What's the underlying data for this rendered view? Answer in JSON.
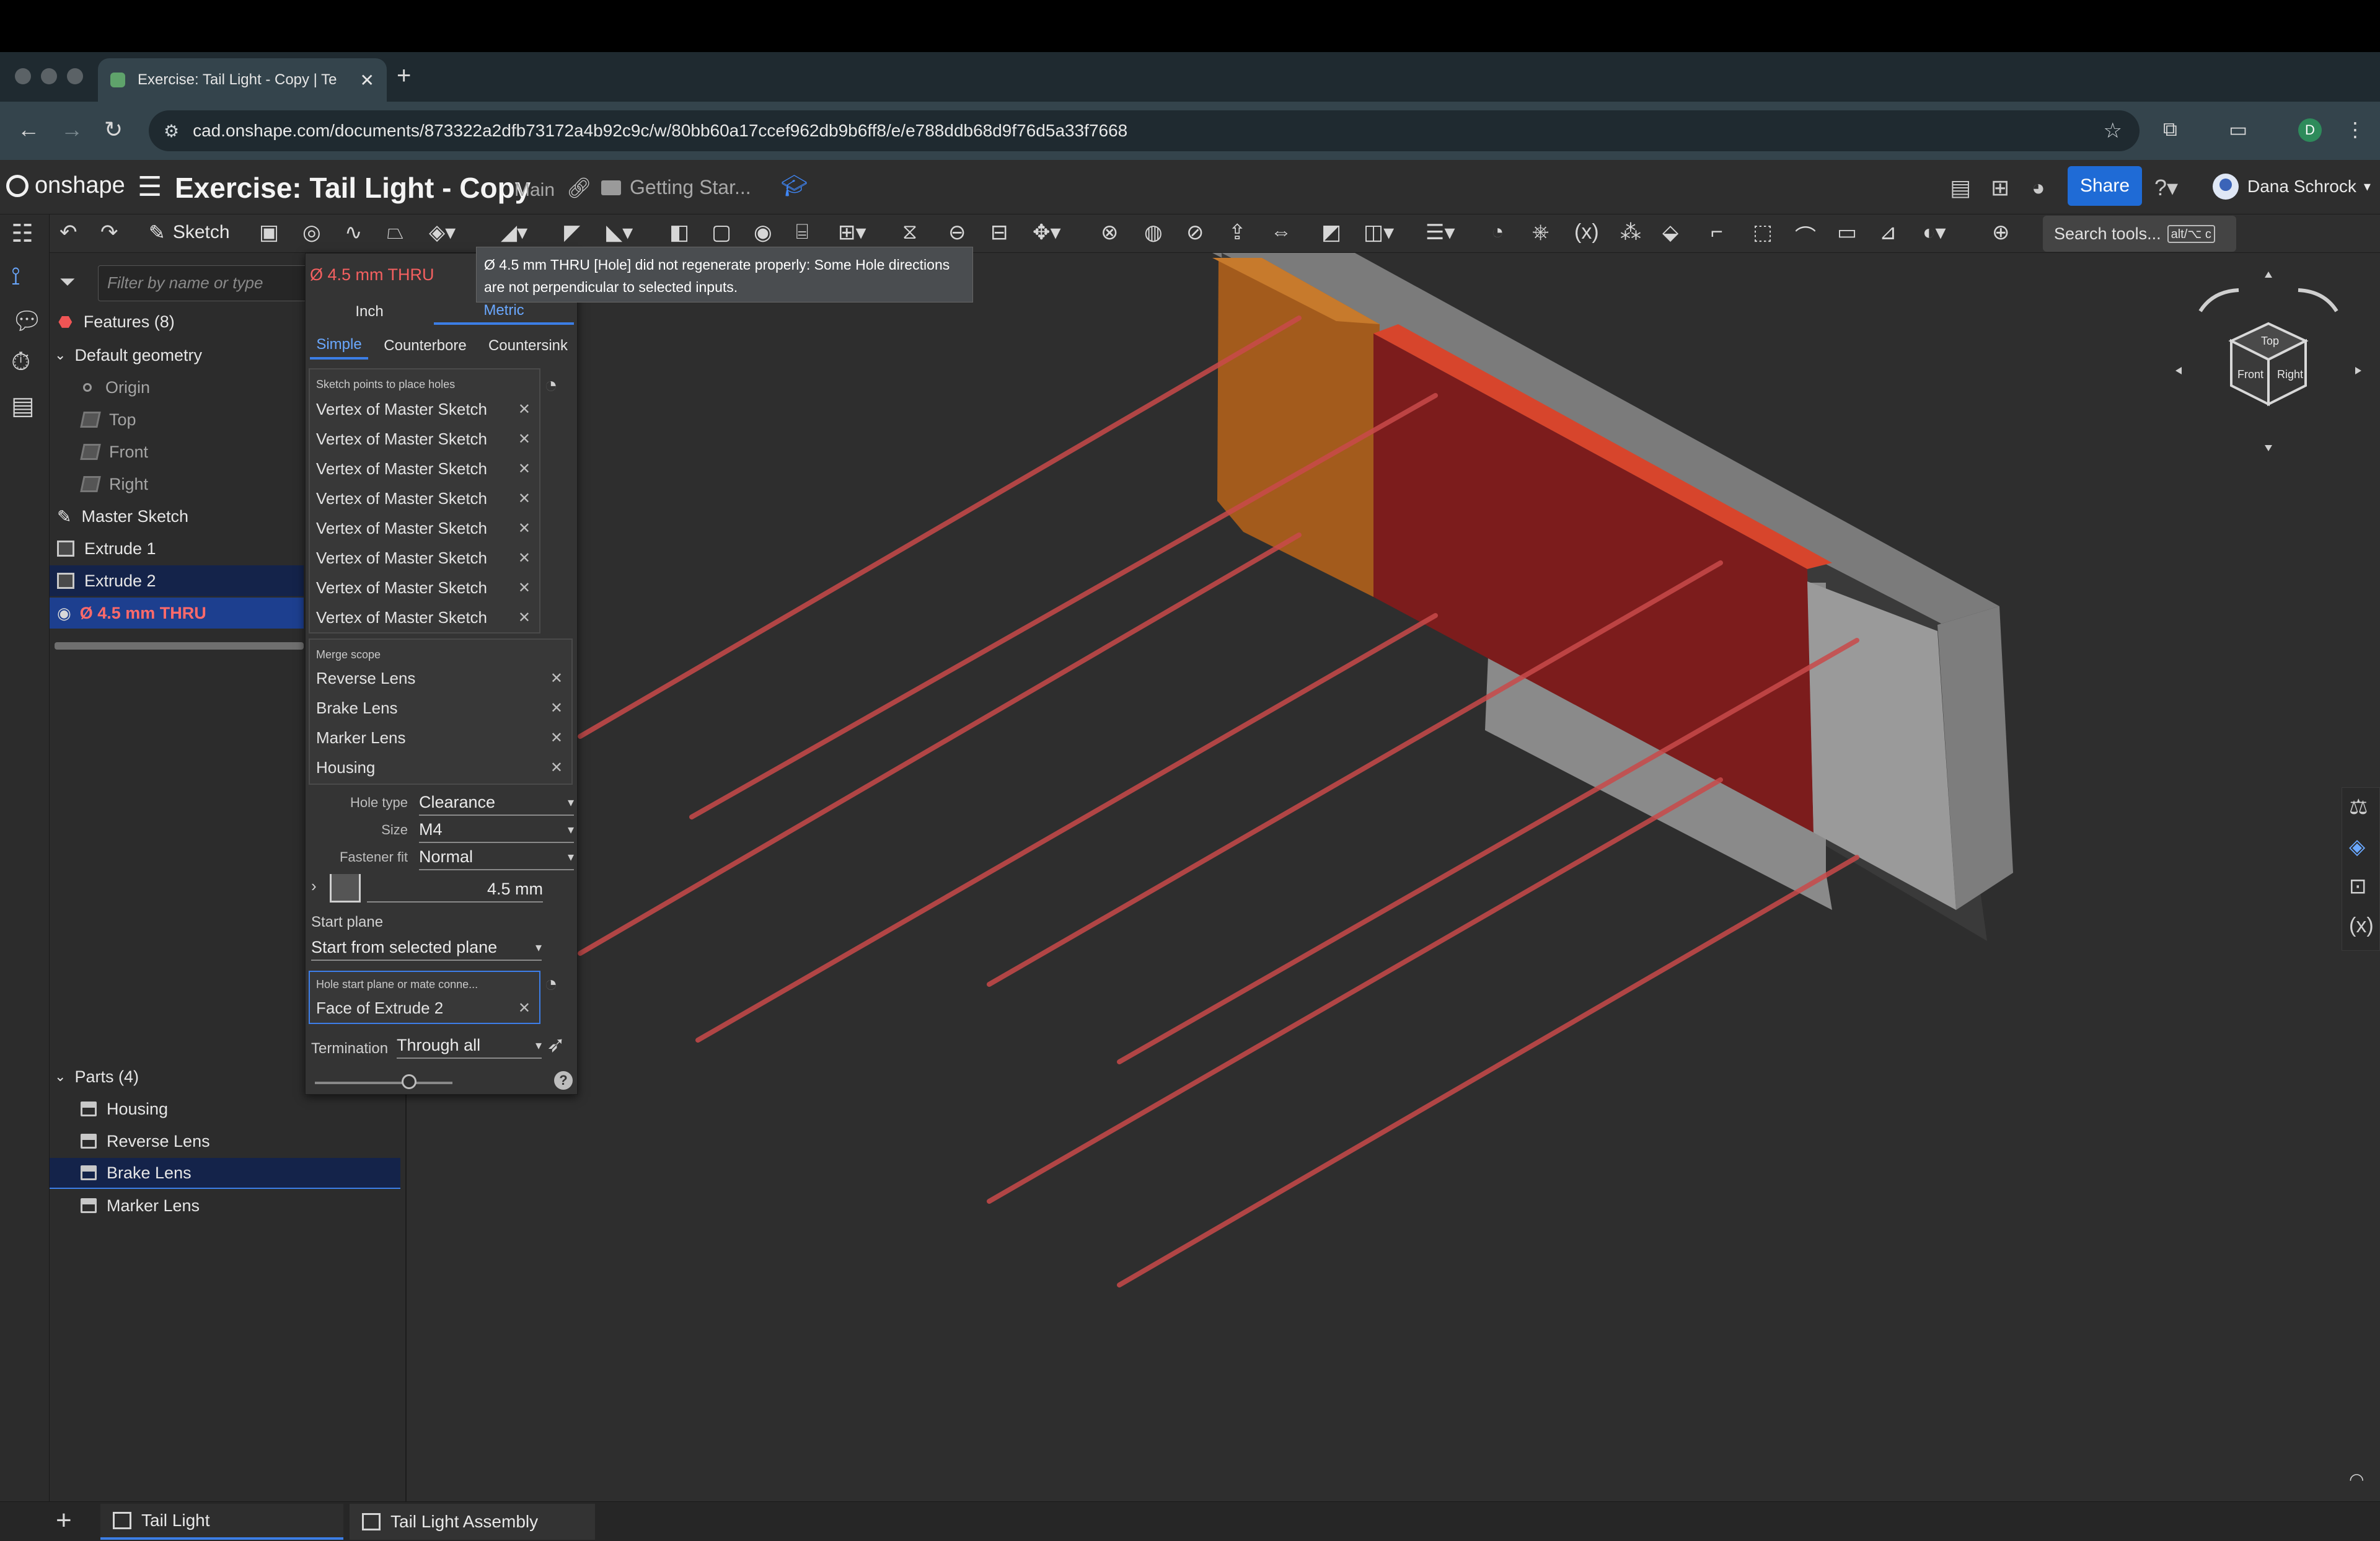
{
  "browser": {
    "tab_title": "Exercise: Tail Light - Copy | Te",
    "tab_close": "✕",
    "new_tab": "+",
    "url": "cad.onshape.com/documents/873322a2dfb73172a4b92c9c/w/80bb60a17ccef962db9b6ff8/e/e788ddb68d9f76d5a33f7668",
    "profile_initial": "D"
  },
  "header": {
    "logo": "onshape",
    "doc_title": "Exercise: Tail Light - Copy",
    "branch": "Main",
    "folder": "Getting Star...",
    "share_label": "Share",
    "user_name": "Dana Schrock"
  },
  "toolbar": {
    "sketch_label": "Sketch",
    "search_placeholder": "Search tools...",
    "search_shortcut": "alt/⌥ c"
  },
  "feature_tree": {
    "filter_placeholder": "Filter by name or type",
    "features_header": "Features (8)",
    "default_geometry": "Default geometry",
    "origin": "Origin",
    "planes": [
      "Top",
      "Front",
      "Right"
    ],
    "features": [
      "Master Sketch",
      "Extrude 1",
      "Extrude 2",
      "Ø 4.5 mm THRU"
    ],
    "parts_header": "Parts (4)",
    "parts": [
      "Housing",
      "Reverse Lens",
      "Brake Lens",
      "Marker Lens"
    ]
  },
  "hole_dialog": {
    "name": "Ø 4.5 mm THRU",
    "error_message": "Ø 4.5 mm THRU [Hole] did not regenerate properly: Some Hole directions are not perpendicular to selected inputs.",
    "unit_tabs": [
      "Inch",
      "Metric"
    ],
    "type_tabs": [
      "Simple",
      "Counterbore",
      "Countersink"
    ],
    "sketch_points_caption": "Sketch points to place holes",
    "sketch_points": [
      "Vertex of Master Sketch",
      "Vertex of Master Sketch",
      "Vertex of Master Sketch",
      "Vertex of Master Sketch",
      "Vertex of Master Sketch",
      "Vertex of Master Sketch",
      "Vertex of Master Sketch",
      "Vertex of Master Sketch"
    ],
    "merge_scope_caption": "Merge scope",
    "merge_scope": [
      "Reverse Lens",
      "Brake Lens",
      "Marker Lens",
      "Housing"
    ],
    "remove_glyph": "✕",
    "hole_type_label": "Hole type",
    "hole_type": "Clearance",
    "size_label": "Size",
    "size": "M4",
    "fastener_fit_label": "Fastener fit",
    "fastener_fit": "Normal",
    "diameter": "4.5 mm",
    "start_plane_label": "Start plane",
    "start_plane": "Start from selected plane",
    "hole_start_caption": "Hole start plane or mate conne...",
    "hole_start_value": "Face of Extrude 2",
    "termination_label": "Termination",
    "termination": "Through all"
  },
  "bottom_tabs": [
    "Tail Light",
    "Tail Light Assembly"
  ],
  "icons": {
    "error": "error-icon",
    "view_cube": "view-cube-icon"
  },
  "colors": {
    "accent": "#3c7ee6",
    "error_text": "#f46060",
    "reverse_lens": "#b5651d",
    "brake_lens": "#8a1c1c",
    "housing": "#8e8e8e"
  }
}
